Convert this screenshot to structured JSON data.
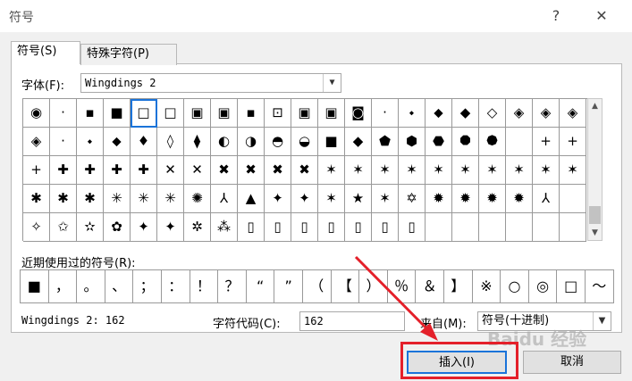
{
  "window": {
    "title": "符号",
    "help": "?",
    "close": "✕"
  },
  "tabs": [
    {
      "label": "符号(S)"
    },
    {
      "label": "特殊字符(P)"
    }
  ],
  "font": {
    "label": "字体(F):",
    "value": "Wingdings 2"
  },
  "symbols": {
    "rows": [
      [
        "◉",
        "·",
        "▪",
        "■",
        "□",
        "□",
        "▣",
        "▣",
        "▪",
        "⊡",
        "▣",
        "▣",
        "◙",
        "·",
        "⬩",
        "⬥",
        "◆",
        "◇",
        "◈",
        "◈",
        "◈"
      ],
      [
        "◈",
        "·",
        "⬩",
        "⬥",
        "♦",
        "◊",
        "⧫",
        "◐",
        "◑",
        "◓",
        "◒",
        "■",
        "◆",
        "⬟",
        "⬢",
        "⬣",
        "⯃",
        "⯄",
        "",
        "+",
        "+"
      ],
      [
        "+",
        "✚",
        "✚",
        "✚",
        "✚",
        "✕",
        "✕",
        "✖",
        "✖",
        "✖",
        "✖",
        "✶",
        "✶",
        "✶",
        "✶",
        "✶",
        "✶",
        "✶",
        "✶",
        "✶",
        "✶"
      ],
      [
        "✱",
        "✱",
        "✱",
        "✳",
        "✳",
        "✳",
        "✺",
        "⅄",
        "▲",
        "✦",
        "✦",
        "✶",
        "★",
        "✶",
        "✡",
        "✹",
        "✹",
        "✹",
        "✹",
        "⅄",
        ""
      ],
      [
        "✧",
        "✩",
        "✫",
        "✿",
        "✦",
        "✦",
        "✲",
        "⁂",
        "▯",
        "▯",
        "▯",
        "▯",
        "▯",
        "▯",
        "▯",
        "",
        "",
        "",
        "",
        "",
        ""
      ]
    ],
    "selected_row": 0,
    "selected_col": 4
  },
  "recent": {
    "label": "近期使用过的符号(R):",
    "items": [
      "■",
      "，",
      "。",
      "、",
      "；",
      "：",
      "！",
      "？",
      "“",
      "”",
      "（",
      "【",
      "）",
      "％",
      "＆",
      "】",
      "※",
      "○",
      "◎",
      "□",
      "～"
    ]
  },
  "footer": {
    "font_info": "Wingdings 2: 162",
    "char_code_label": "字符代码(C):",
    "char_code_value": "162",
    "from_label": "来自(M):",
    "from_value": "符号(十进制)"
  },
  "buttons": {
    "insert": "插入(I)",
    "cancel": "取消"
  },
  "watermark": "Baidu 经验",
  "colors": {
    "annotation": "#e4202a",
    "selection": "#1a73d9"
  }
}
